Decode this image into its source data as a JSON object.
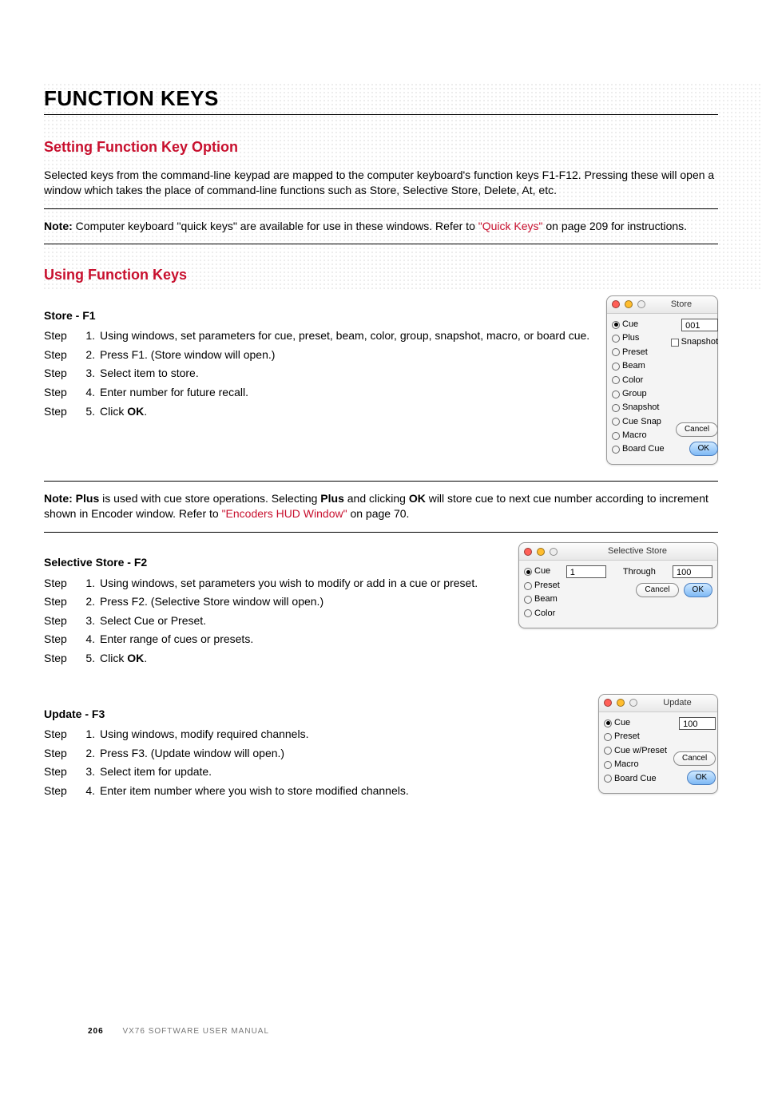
{
  "page": {
    "number": "206",
    "footer": "VX76 SOFTWARE USER MANUAL"
  },
  "headings": {
    "main": "FUNCTION KEYS",
    "h2a": "Setting Function Key Option",
    "h2b": "Using Function Keys"
  },
  "paragraphs": {
    "intro": "Selected keys from the command-line keypad are mapped to the computer keyboard's function keys F1-F12. Pressing these will open a window which takes the place of command-line functions such as Store, Selective Store, Delete, At, etc."
  },
  "notes": {
    "n1_prefix": "Note:",
    "n1_a": " Computer keyboard \"quick keys\" are available for use in these windows. Refer to ",
    "n1_link": "\"Quick Keys\"",
    "n1_b": " on page 209 for instructions.",
    "n2_prefix": "Note:",
    "n2_a": " Plus",
    "n2_b": " is used with cue store operations. Selecting ",
    "n2_c": "Plus",
    "n2_d": " and clicking ",
    "n2_e": "OK",
    "n2_f": " will store cue to next cue number according to increment shown in Encoder window. Refer to ",
    "n2_link": "\"Encoders HUD Window\"",
    "n2_g": " on page 70."
  },
  "sections": {
    "store": {
      "title": "Store - F1",
      "steps": [
        "Using windows, set parameters for cue, preset, beam, color, group, snapshot, macro, or board cue.",
        "Press F1. (Store window will open.)",
        "Select item to store.",
        "Enter number for future recall.",
        "Click OK."
      ]
    },
    "selstore": {
      "title": "Selective Store - F2",
      "steps": [
        "Using windows, set parameters you wish to modify or add in a cue or preset.",
        "Press F2. (Selective Store window will open.)",
        "Select Cue or Preset.",
        "Enter range of cues or presets.",
        "Click OK."
      ]
    },
    "update": {
      "title": "Update - F3",
      "steps": [
        "Using windows, modify required channels.",
        "Press F3. (Update window will open.)",
        "Select item for update.",
        "Enter item number where you wish to store modified channels."
      ]
    }
  },
  "step_word": "Step",
  "dialogs": {
    "store": {
      "title": "Store",
      "radios": [
        "Cue",
        "Plus",
        "Preset",
        "Beam",
        "Color",
        "Group",
        "Snapshot",
        "Cue Snap",
        "Macro",
        "Board Cue"
      ],
      "selected": 0,
      "input": "001",
      "checkbox": "Snapshot",
      "cancel": "Cancel",
      "ok": "OK"
    },
    "selstore": {
      "title": "Selective Store",
      "radios": [
        "Cue",
        "Preset",
        "Beam",
        "Color"
      ],
      "selected": 0,
      "from": "1",
      "through_label": "Through",
      "to": "100",
      "cancel": "Cancel",
      "ok": "OK"
    },
    "update": {
      "title": "Update",
      "radios": [
        "Cue",
        "Preset",
        "Cue w/Preset",
        "Macro",
        "Board Cue"
      ],
      "selected": 0,
      "input": "100",
      "cancel": "Cancel",
      "ok": "OK"
    }
  }
}
